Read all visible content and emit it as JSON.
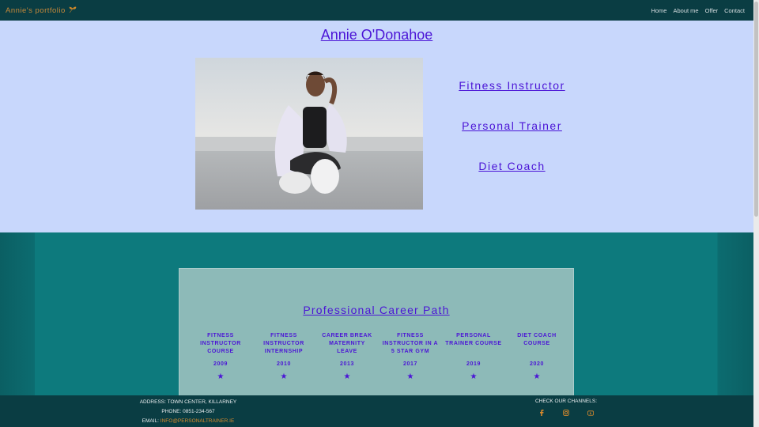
{
  "nav": {
    "brand": "Annie's portfolio",
    "brand_icon": "leaf-icon",
    "links": [
      "Home",
      "About me",
      "Offer",
      "Contact"
    ]
  },
  "hero": {
    "title": "Annie O'Donahoe",
    "roles": [
      "Fitness Instructor",
      "Personal Trainer",
      "Diet Coach"
    ]
  },
  "career": {
    "title": "Professional Career Path",
    "items": [
      {
        "label": "Fitness Instructor Course",
        "year": "2009"
      },
      {
        "label": "Fitness Instructor Internship",
        "year": "2010"
      },
      {
        "label": "Career Break Maternity Leave",
        "year": "2013"
      },
      {
        "label": "Fitness Instructor in a 5 Star Gym",
        "year": "2017"
      },
      {
        "label": "Personal Trainer Course",
        "year": "2019"
      },
      {
        "label": "Diet Coach Course",
        "year": "2020"
      }
    ]
  },
  "footer": {
    "address": "ADDRESS: TOWN CENTER, KILLARNEY",
    "phone": "PHONE: 0851-234-567",
    "email_label": "EMAIL:",
    "email": "INFO@PERSONALTRAINER.IE",
    "channels_label": "CHECK OUR CHANNELS:",
    "channels": [
      "facebook-icon",
      "instagram-icon",
      "youtube-icon"
    ]
  },
  "colors": {
    "accent": "#4b14d6",
    "hero_bg": "#c8d7fc",
    "nav_bg": "#0a3d43",
    "orange": "#d98a2c"
  }
}
